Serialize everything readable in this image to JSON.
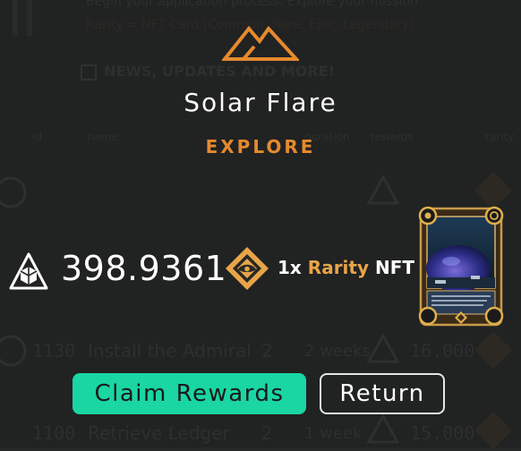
{
  "background": {
    "header_line": "Begin your application process. Explore your mission",
    "rarity_line": "Rarity = NFT Card (Common, Rare, Epic, Legendary)",
    "checkbox_label": "NEWS, UPDATES AND MORE!",
    "columns": {
      "id": "id",
      "name": "name",
      "duration": "duration",
      "rewards": "rewards",
      "rarity": "rarity"
    },
    "rows": [
      {
        "id": "1130",
        "name": "Install the Admiral",
        "level": "2",
        "duration": "2 weeks",
        "reward": "16.000"
      },
      {
        "id": "1100",
        "name": "Retrieve Ledger",
        "level": "2",
        "duration": "1 week",
        "reward": "15.000"
      }
    ]
  },
  "modal": {
    "logo_icon": "mountain-logo-icon",
    "mission_title": "Solar Flare",
    "mission_type": "EXPLORE",
    "token_icon": "cube-token-icon",
    "token_amount": "398.9361",
    "rarity_icon": "rarity-diamond-icon",
    "nft_quantity": "1x",
    "nft_rarity": "Rarity",
    "nft_suffix": "NFT",
    "nft_card_icon": "nft-card-image"
  },
  "buttons": {
    "claim": "Claim Rewards",
    "return": "Return"
  },
  "colors": {
    "background": "#262727",
    "accent_orange": "#e58a2e",
    "rarity_gold": "#e8a547",
    "claim_green": "#19d6a3",
    "white": "#ffffff"
  }
}
